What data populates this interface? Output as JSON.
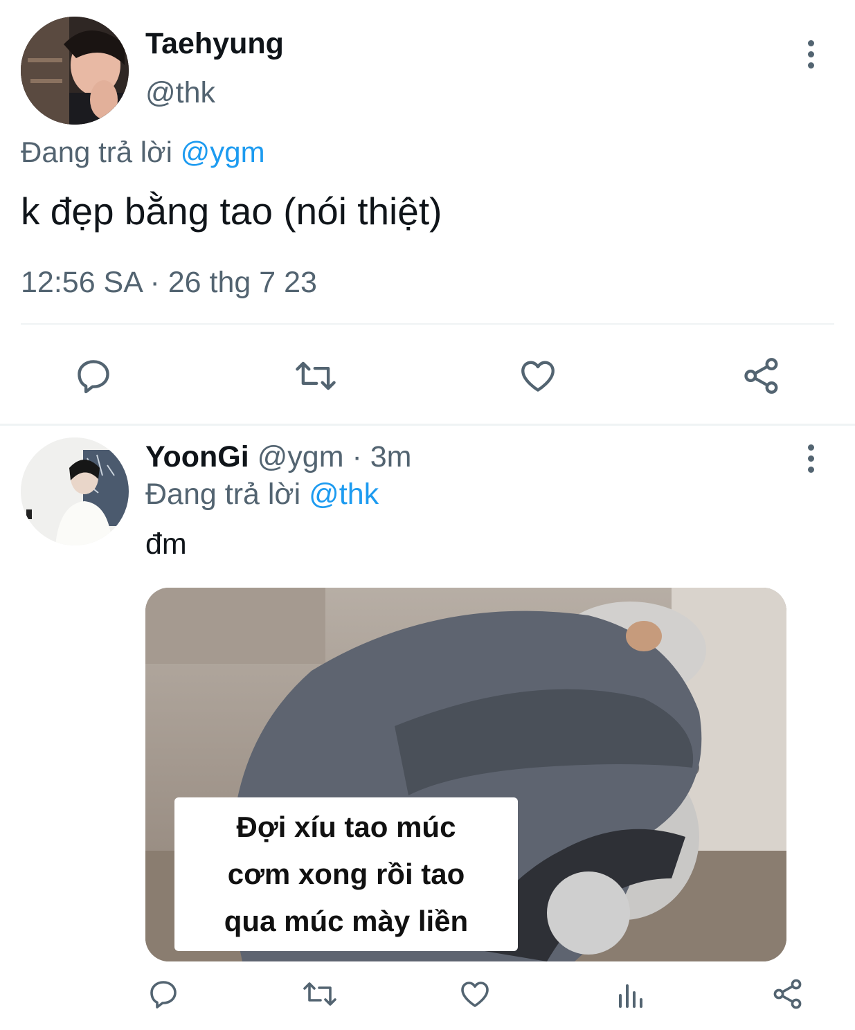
{
  "tweet": {
    "author_name": "Taehyung",
    "author_handle": "@thk",
    "reply_prefix": "Đang trả lời",
    "reply_to": "@ygm",
    "text": "k đẹp bằng tao (nói thiệt)",
    "timestamp": "12:56 SA · 26 thg 7 23",
    "actions": [
      "reply-icon",
      "retweet-icon",
      "like-icon",
      "share-icon"
    ]
  },
  "reply": {
    "author_name": "YoonGi",
    "author_handle": "@ygm",
    "separator": "·",
    "time_ago": "3m",
    "reply_prefix": "Đang trả lời",
    "reply_to": "@thk",
    "text": "đm",
    "media_caption": [
      "Đợi xíu tao múc",
      "cơm xong rồi tao",
      "qua múc mày liền"
    ],
    "actions": [
      "reply-icon",
      "retweet-icon",
      "like-icon",
      "views-icon",
      "share-icon"
    ]
  },
  "colors": {
    "text": "#0f1419",
    "secondary": "#536471",
    "link": "#1d9bf0",
    "divider": "#eff3f4"
  }
}
